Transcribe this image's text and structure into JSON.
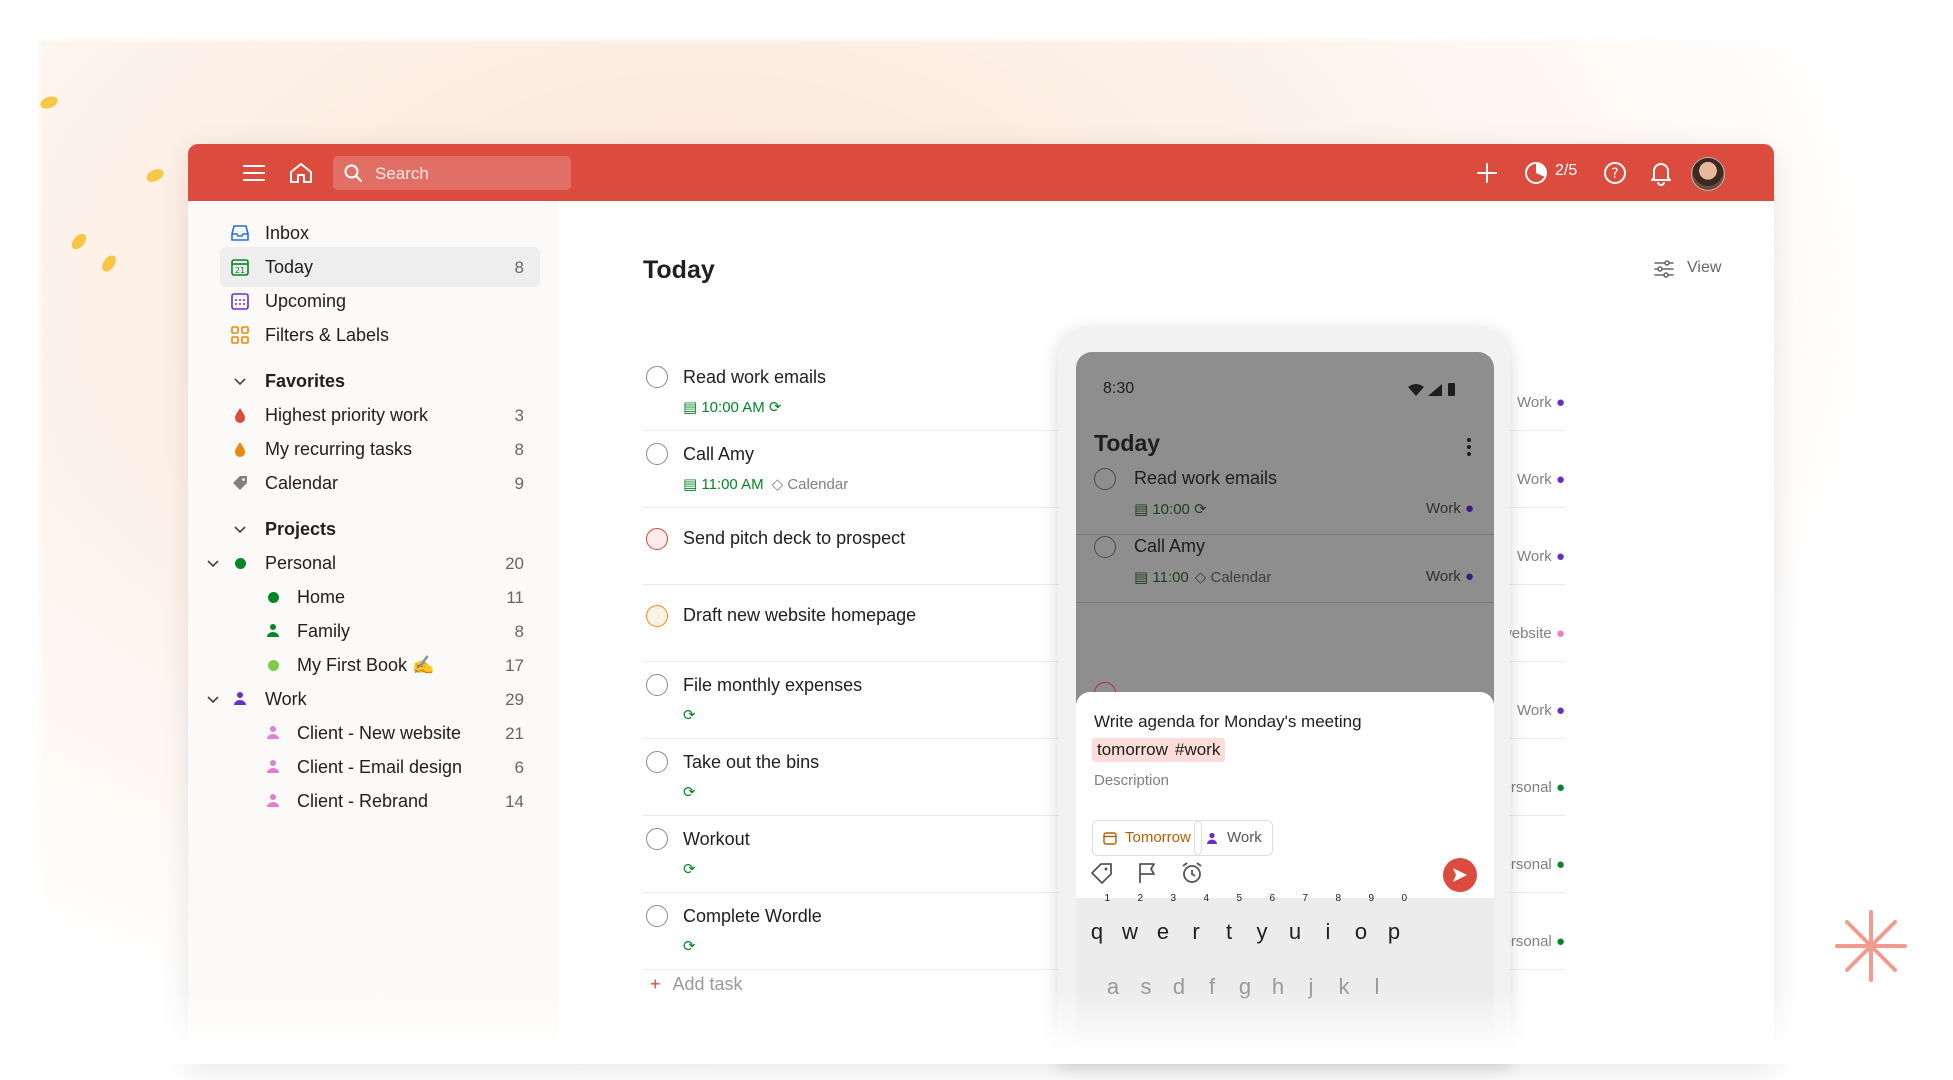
{
  "topbar": {
    "search_placeholder": "Search",
    "karma": "2/5",
    "icons": [
      "menu-icon",
      "home-icon",
      "search-icon",
      "plus-icon",
      "karma-icon",
      "help-icon",
      "bell-icon",
      "avatar"
    ],
    "color": "#db4c3f"
  },
  "sidebar": {
    "nav": [
      {
        "label": "Inbox",
        "count": ""
      },
      {
        "label": "Today",
        "count": "8"
      },
      {
        "label": "Upcoming",
        "count": ""
      },
      {
        "label": "Filters & Labels",
        "count": ""
      }
    ],
    "favorites": {
      "heading": "Favorites",
      "items": [
        {
          "label": "Highest priority work",
          "count": "3",
          "color": "#db4c3f"
        },
        {
          "label": "My recurring tasks",
          "count": "8",
          "color": "#eb8909"
        },
        {
          "label": "Calendar",
          "count": "9",
          "color": "#808080"
        }
      ]
    },
    "projects": {
      "heading": "Projects",
      "items": [
        {
          "label": "Personal",
          "count": "20",
          "color": "#058527"
        },
        {
          "label": "Home",
          "count": "11",
          "color": "#058527"
        },
        {
          "label": "Family",
          "count": "8",
          "color": "#058527"
        },
        {
          "label": "My First Book ✍️",
          "count": "17",
          "color": "#7ecc49"
        },
        {
          "label": "Work",
          "count": "29",
          "color": "#692fc2"
        },
        {
          "label": "Client - New website",
          "count": "21",
          "color": "#e07fd3"
        },
        {
          "label": "Client - Email design",
          "count": "6",
          "color": "#e07fd3"
        },
        {
          "label": "Client - Rebrand",
          "count": "14",
          "color": "#e07fd3"
        }
      ]
    }
  },
  "main": {
    "title": "Today",
    "view_label": "View",
    "tasks": [
      {
        "title": "Read work emails",
        "time": "10:00 AM",
        "extra": "",
        "project": "Work"
      },
      {
        "title": "Call Amy",
        "time": "11:00 AM",
        "extra": "Calendar",
        "project": "Work"
      },
      {
        "title": "Send pitch deck to prospect",
        "time": "",
        "extra": "",
        "project": "Work"
      },
      {
        "title": "Draft new website homepage",
        "time": "",
        "extra": "",
        "project": "Client - New website"
      },
      {
        "title": "File monthly expenses",
        "time": "",
        "extra": "",
        "project": "Work"
      },
      {
        "title": "Take out the bins",
        "time": "",
        "extra": "",
        "project": "Personal"
      },
      {
        "title": "Workout",
        "time": "",
        "extra": "",
        "project": "Personal"
      },
      {
        "title": "Complete Wordle",
        "time": "",
        "extra": "",
        "project": "Personal"
      }
    ],
    "add_task": "Add task"
  },
  "phone": {
    "time": "8:30",
    "title": "Today",
    "tasks": [
      {
        "title": "Read work emails",
        "time": "10:00",
        "extra": "",
        "project": "Work"
      },
      {
        "title": "Call Amy",
        "time": "11:00",
        "extra": "Calendar",
        "project": "Work"
      }
    ],
    "composer": {
      "text": "Write agenda for Monday's meeting",
      "chip_date": "tomorrow",
      "chip_label": "#work",
      "description": "Description",
      "date_button": "Tomorrow",
      "project_button": "Work"
    },
    "keyboard": {
      "row1": [
        "q",
        "w",
        "e",
        "r",
        "t",
        "y",
        "u",
        "i",
        "o",
        "p"
      ],
      "row1_nums": [
        "1",
        "2",
        "3",
        "4",
        "5",
        "6",
        "7",
        "8",
        "9",
        "0"
      ],
      "row2": [
        "a",
        "s",
        "d",
        "f",
        "g",
        "h",
        "j",
        "k",
        "l"
      ]
    }
  }
}
